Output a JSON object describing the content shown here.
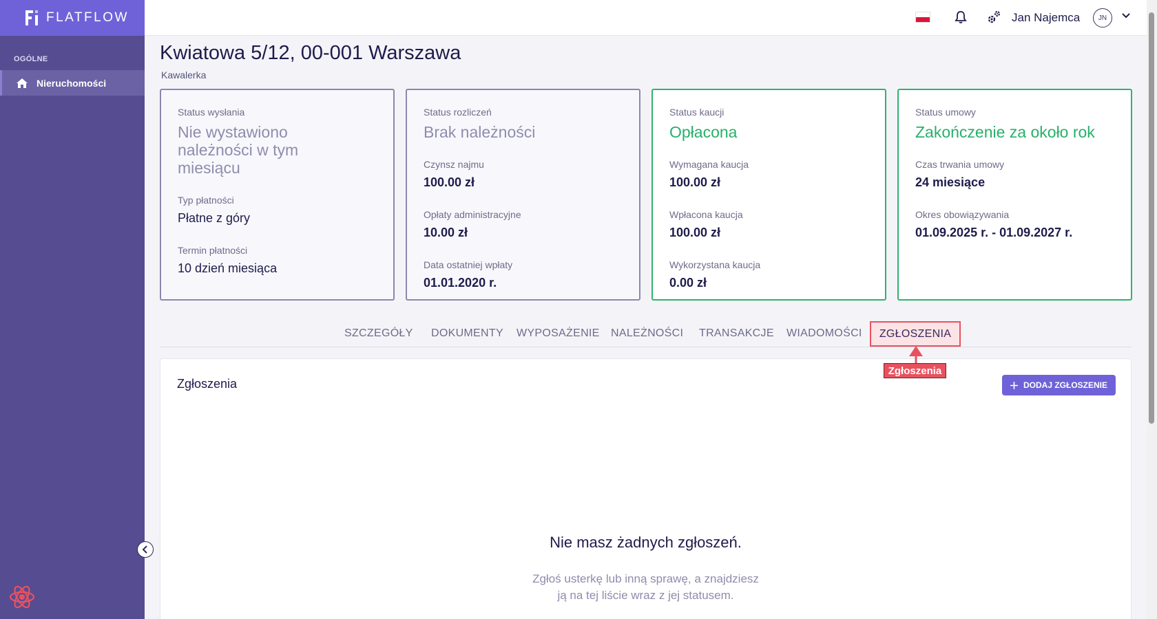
{
  "brand": {
    "name": "FLATFLOW"
  },
  "sidebar": {
    "section": "OGÓLNE",
    "items": [
      {
        "label": "Nieruchomości",
        "icon": "home-icon"
      }
    ]
  },
  "topbar": {
    "user_name": "Jan Najemca",
    "avatar_initials": "JN",
    "icons": [
      "poland-flag-icon",
      "bell-icon",
      "gears-icon",
      "chevron-down-icon"
    ]
  },
  "property": {
    "title": "Kwiatowa 5/12, 00-001 Warszawa",
    "type": "Kawalerka"
  },
  "cards": [
    {
      "label": "Status wysłania",
      "status": "Nie wystawiono należności w tym miesiącu",
      "fields": [
        {
          "label": "Typ płatności",
          "value": "Płatne z góry"
        },
        {
          "label": "Termin płatności",
          "value": "10 dzień miesiąca"
        }
      ]
    },
    {
      "label": "Status rozliczeń",
      "status": "Brak należności",
      "fields": [
        {
          "label": "Czynsz najmu",
          "value": "100.00 zł"
        },
        {
          "label": "Opłaty administracyjne",
          "value": "10.00 zł"
        },
        {
          "label": "Data ostatniej wpłaty",
          "value": "01.01.2020 r."
        }
      ]
    },
    {
      "label": "Status kaucji",
      "status": "Opłacona",
      "fields": [
        {
          "label": "Wymagana kaucja",
          "value": "100.00 zł"
        },
        {
          "label": "Wpłacona kaucja",
          "value": "100.00 zł"
        },
        {
          "label": "Wykorzystana kaucja",
          "value": "0.00 zł"
        }
      ]
    },
    {
      "label": "Status umowy",
      "status": "Zakończenie za około rok",
      "fields": [
        {
          "label": "Czas trwania umowy",
          "value": "24 miesiące"
        },
        {
          "label": "Okres obowiązywania",
          "value": "01.09.2025 r. - 01.09.2027 r."
        }
      ]
    }
  ],
  "tabs": [
    "SZCZEGÓŁY",
    "DOKUMENTY",
    "WYPOSAŻENIE",
    "NALEŻNOŚCI",
    "TRANSAKCJE",
    "WIADOMOŚCI",
    "ZGŁOSZENIA"
  ],
  "active_tab": "ZGŁOSZENIA",
  "tooltip": "Zgłoszenia",
  "panel": {
    "title": "Zgłoszenia",
    "add_button": "DODAJ ZGŁOSZENIE",
    "empty_title": "Nie masz żadnych zgłoszeń.",
    "empty_desc_line1": "Zgłoś usterkę lub inną sprawę, a znajdziesz",
    "empty_desc_line2": "ją na tej liście wraz z jej statusem."
  },
  "colors": {
    "accent": "#6f62d8",
    "sidebar": "#564c91",
    "success": "#27b069",
    "highlight": "#e8525f"
  }
}
